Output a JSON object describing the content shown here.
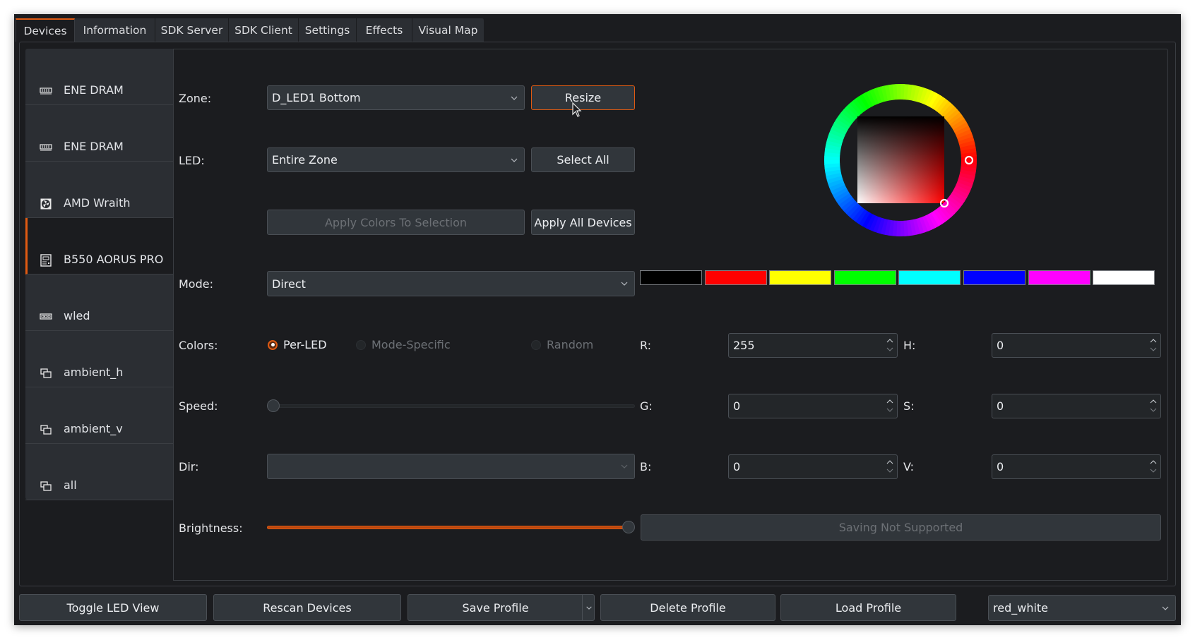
{
  "tabs": [
    {
      "label": "Devices",
      "active": true
    },
    {
      "label": "Information"
    },
    {
      "label": "SDK Server"
    },
    {
      "label": "SDK Client"
    },
    {
      "label": "Settings"
    },
    {
      "label": "Effects"
    },
    {
      "label": "Visual Map"
    }
  ],
  "devices": [
    {
      "label": "ENE DRAM",
      "icon": "ram-icon"
    },
    {
      "label": "ENE DRAM",
      "icon": "ram-icon"
    },
    {
      "label": "AMD Wraith",
      "icon": "cooler-icon"
    },
    {
      "label": "B550 AORUS PRO",
      "icon": "motherboard-icon",
      "selected": true
    },
    {
      "label": "wled",
      "icon": "ledstrip-icon"
    },
    {
      "label": "ambient_h",
      "icon": "virtual-device-icon"
    },
    {
      "label": "ambient_v",
      "icon": "virtual-device-icon"
    },
    {
      "label": "all",
      "icon": "virtual-device-icon"
    }
  ],
  "controls": {
    "zone_label": "Zone:",
    "zone_value": "D_LED1 Bottom",
    "resize_label": "Resize",
    "led_label": "LED:",
    "led_value": "Entire Zone",
    "select_all_label": "Select All",
    "apply_selection_label": "Apply Colors To Selection",
    "apply_all_label": "Apply All Devices",
    "mode_label": "Mode:",
    "mode_value": "Direct",
    "colors_label": "Colors:",
    "color_modes": [
      {
        "label": "Per-LED",
        "checked": true,
        "enabled": true
      },
      {
        "label": "Mode-Specific",
        "checked": false,
        "enabled": false
      },
      {
        "label": "Random",
        "checked": false,
        "enabled": false
      }
    ],
    "speed_label": "Speed:",
    "speed_fraction": 0,
    "dir_label": "Dir:",
    "dir_value": "",
    "brightness_label": "Brightness:",
    "brightness_fraction": 1.0,
    "saving_label": "Saving Not Supported"
  },
  "color": {
    "swatches": [
      "#000000",
      "#ff0000",
      "#ffff00",
      "#00ff00",
      "#00ffff",
      "#0000ff",
      "#ff00ff",
      "#ffffff"
    ],
    "rgb": [
      {
        "label": "R:",
        "value": "255"
      },
      {
        "label": "G:",
        "value": "0"
      },
      {
        "label": "B:",
        "value": "0"
      }
    ],
    "hsv": [
      {
        "label": "H:",
        "value": "0"
      },
      {
        "label": "S:",
        "value": "0"
      },
      {
        "label": "V:",
        "value": "0"
      }
    ],
    "wheel_hue_deg": 0
  },
  "footer": {
    "toggle_led_view": "Toggle LED View",
    "rescan_devices": "Rescan Devices",
    "save_profile": "Save Profile",
    "delete_profile": "Delete Profile",
    "load_profile": "Load Profile",
    "profile_value": "red_white"
  },
  "theme": {
    "accent": "#e05a12"
  }
}
